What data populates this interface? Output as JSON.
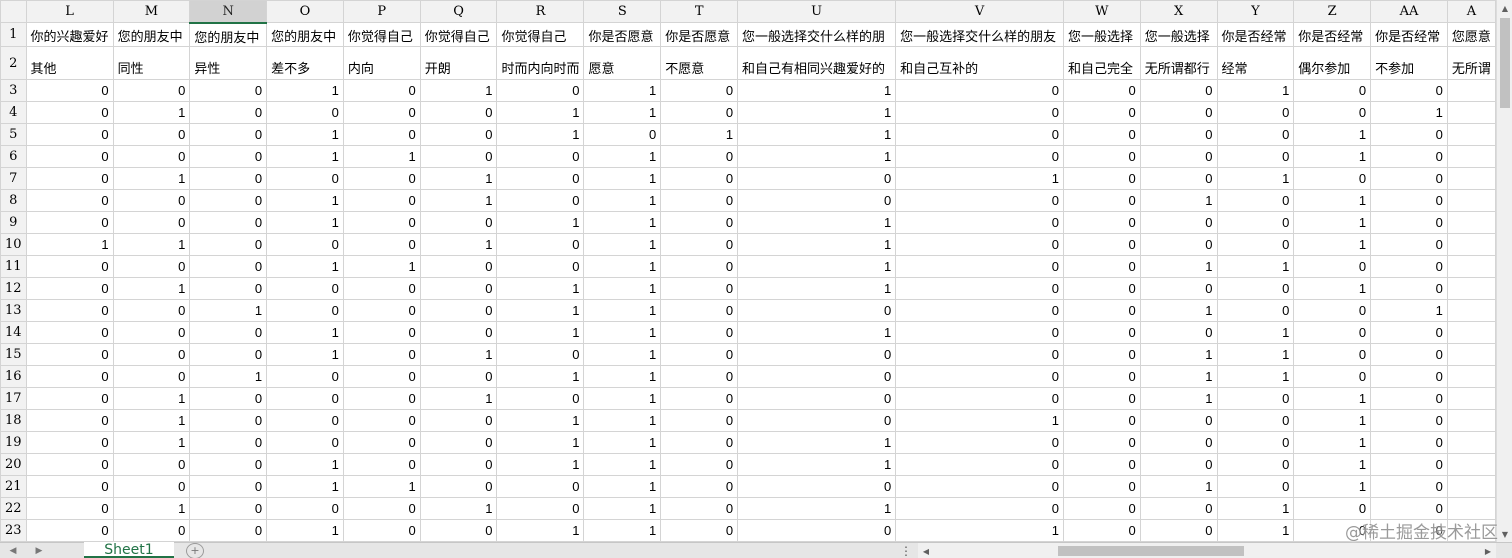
{
  "app": {
    "sheet_tab": "Sheet1",
    "add_sheet_symbol": "+",
    "split_symbol": "⋮"
  },
  "columns": [
    "L",
    "M",
    "N",
    "O",
    "P",
    "Q",
    "R",
    "S",
    "T",
    "U",
    "V",
    "W",
    "X",
    "Y",
    "Z",
    "AA",
    "A"
  ],
  "selected_column": "N",
  "header_row1": [
    "你的兴趣爱好",
    "您的朋友中",
    "您的朋友中",
    "您的朋友中",
    "你觉得自己",
    "你觉得自己",
    "你觉得自己",
    "你是否愿意",
    "你是否愿意",
    "您一般选择交什么样的朋",
    "您一般选择交什么样的朋友",
    "您一般选择",
    "您一般选择",
    "你是否经常",
    "你是否经常",
    "你是否经常",
    "您愿意"
  ],
  "header_row2": [
    "其他",
    "同性",
    "异性",
    "差不多",
    "内向",
    "开朗",
    "时而内向时而",
    "愿意",
    "不愿意",
    "和自己有相同兴趣爱好的",
    "和自己互补的",
    "和自己完全",
    "无所谓都行",
    "经常",
    "偶尔参加",
    "不参加",
    "无所谓"
  ],
  "rows": [
    {
      "n": "3",
      "v": [
        "0",
        "0",
        "0",
        "1",
        "0",
        "1",
        "0",
        "1",
        "0",
        "1",
        "0",
        "0",
        "0",
        "1",
        "0",
        "0",
        ""
      ]
    },
    {
      "n": "4",
      "v": [
        "0",
        "1",
        "0",
        "0",
        "0",
        "0",
        "1",
        "1",
        "0",
        "1",
        "0",
        "0",
        "0",
        "0",
        "0",
        "1",
        ""
      ]
    },
    {
      "n": "5",
      "v": [
        "0",
        "0",
        "0",
        "1",
        "0",
        "0",
        "1",
        "0",
        "1",
        "1",
        "0",
        "0",
        "0",
        "0",
        "1",
        "0",
        ""
      ]
    },
    {
      "n": "6",
      "v": [
        "0",
        "0",
        "0",
        "1",
        "1",
        "0",
        "0",
        "1",
        "0",
        "1",
        "0",
        "0",
        "0",
        "0",
        "1",
        "0",
        ""
      ]
    },
    {
      "n": "7",
      "v": [
        "0",
        "1",
        "0",
        "0",
        "0",
        "1",
        "0",
        "1",
        "0",
        "0",
        "1",
        "0",
        "0",
        "1",
        "0",
        "0",
        ""
      ]
    },
    {
      "n": "8",
      "v": [
        "0",
        "0",
        "0",
        "1",
        "0",
        "1",
        "0",
        "1",
        "0",
        "0",
        "0",
        "0",
        "1",
        "0",
        "1",
        "0",
        ""
      ]
    },
    {
      "n": "9",
      "v": [
        "0",
        "0",
        "0",
        "1",
        "0",
        "0",
        "1",
        "1",
        "0",
        "1",
        "0",
        "0",
        "0",
        "0",
        "1",
        "0",
        ""
      ]
    },
    {
      "n": "10",
      "v": [
        "1",
        "1",
        "0",
        "0",
        "0",
        "1",
        "0",
        "1",
        "0",
        "1",
        "0",
        "0",
        "0",
        "0",
        "1",
        "0",
        ""
      ]
    },
    {
      "n": "11",
      "v": [
        "0",
        "0",
        "0",
        "1",
        "1",
        "0",
        "0",
        "1",
        "0",
        "1",
        "0",
        "0",
        "1",
        "1",
        "0",
        "0",
        ""
      ]
    },
    {
      "n": "12",
      "v": [
        "0",
        "1",
        "0",
        "0",
        "0",
        "0",
        "1",
        "1",
        "0",
        "1",
        "0",
        "0",
        "0",
        "0",
        "1",
        "0",
        ""
      ]
    },
    {
      "n": "13",
      "v": [
        "0",
        "0",
        "1",
        "0",
        "0",
        "0",
        "1",
        "1",
        "0",
        "0",
        "0",
        "0",
        "1",
        "0",
        "0",
        "1",
        ""
      ]
    },
    {
      "n": "14",
      "v": [
        "0",
        "0",
        "0",
        "1",
        "0",
        "0",
        "1",
        "1",
        "0",
        "1",
        "0",
        "0",
        "0",
        "1",
        "0",
        "0",
        ""
      ]
    },
    {
      "n": "15",
      "v": [
        "0",
        "0",
        "0",
        "1",
        "0",
        "1",
        "0",
        "1",
        "0",
        "0",
        "0",
        "0",
        "1",
        "1",
        "0",
        "0",
        ""
      ]
    },
    {
      "n": "16",
      "v": [
        "0",
        "0",
        "1",
        "0",
        "0",
        "0",
        "1",
        "1",
        "0",
        "0",
        "0",
        "0",
        "1",
        "1",
        "0",
        "0",
        ""
      ]
    },
    {
      "n": "17",
      "v": [
        "0",
        "1",
        "0",
        "0",
        "0",
        "1",
        "0",
        "1",
        "0",
        "0",
        "0",
        "0",
        "1",
        "0",
        "1",
        "0",
        ""
      ]
    },
    {
      "n": "18",
      "v": [
        "0",
        "1",
        "0",
        "0",
        "0",
        "0",
        "1",
        "1",
        "0",
        "0",
        "1",
        "0",
        "0",
        "0",
        "1",
        "0",
        ""
      ]
    },
    {
      "n": "19",
      "v": [
        "0",
        "1",
        "0",
        "0",
        "0",
        "0",
        "1",
        "1",
        "0",
        "1",
        "0",
        "0",
        "0",
        "0",
        "1",
        "0",
        ""
      ]
    },
    {
      "n": "20",
      "v": [
        "0",
        "0",
        "0",
        "1",
        "0",
        "0",
        "1",
        "1",
        "0",
        "1",
        "0",
        "0",
        "0",
        "0",
        "1",
        "0",
        ""
      ]
    },
    {
      "n": "21",
      "v": [
        "0",
        "0",
        "0",
        "1",
        "1",
        "0",
        "0",
        "1",
        "0",
        "0",
        "0",
        "0",
        "1",
        "0",
        "1",
        "0",
        ""
      ]
    },
    {
      "n": "22",
      "v": [
        "0",
        "1",
        "0",
        "0",
        "0",
        "1",
        "0",
        "1",
        "0",
        "1",
        "0",
        "0",
        "0",
        "1",
        "0",
        "0",
        ""
      ]
    },
    {
      "n": "23",
      "v": [
        "0",
        "0",
        "0",
        "1",
        "0",
        "0",
        "1",
        "1",
        "0",
        "0",
        "1",
        "0",
        "0",
        "1",
        "0",
        "0",
        ""
      ]
    }
  ],
  "watermark": "@稀土掘金技术社区"
}
